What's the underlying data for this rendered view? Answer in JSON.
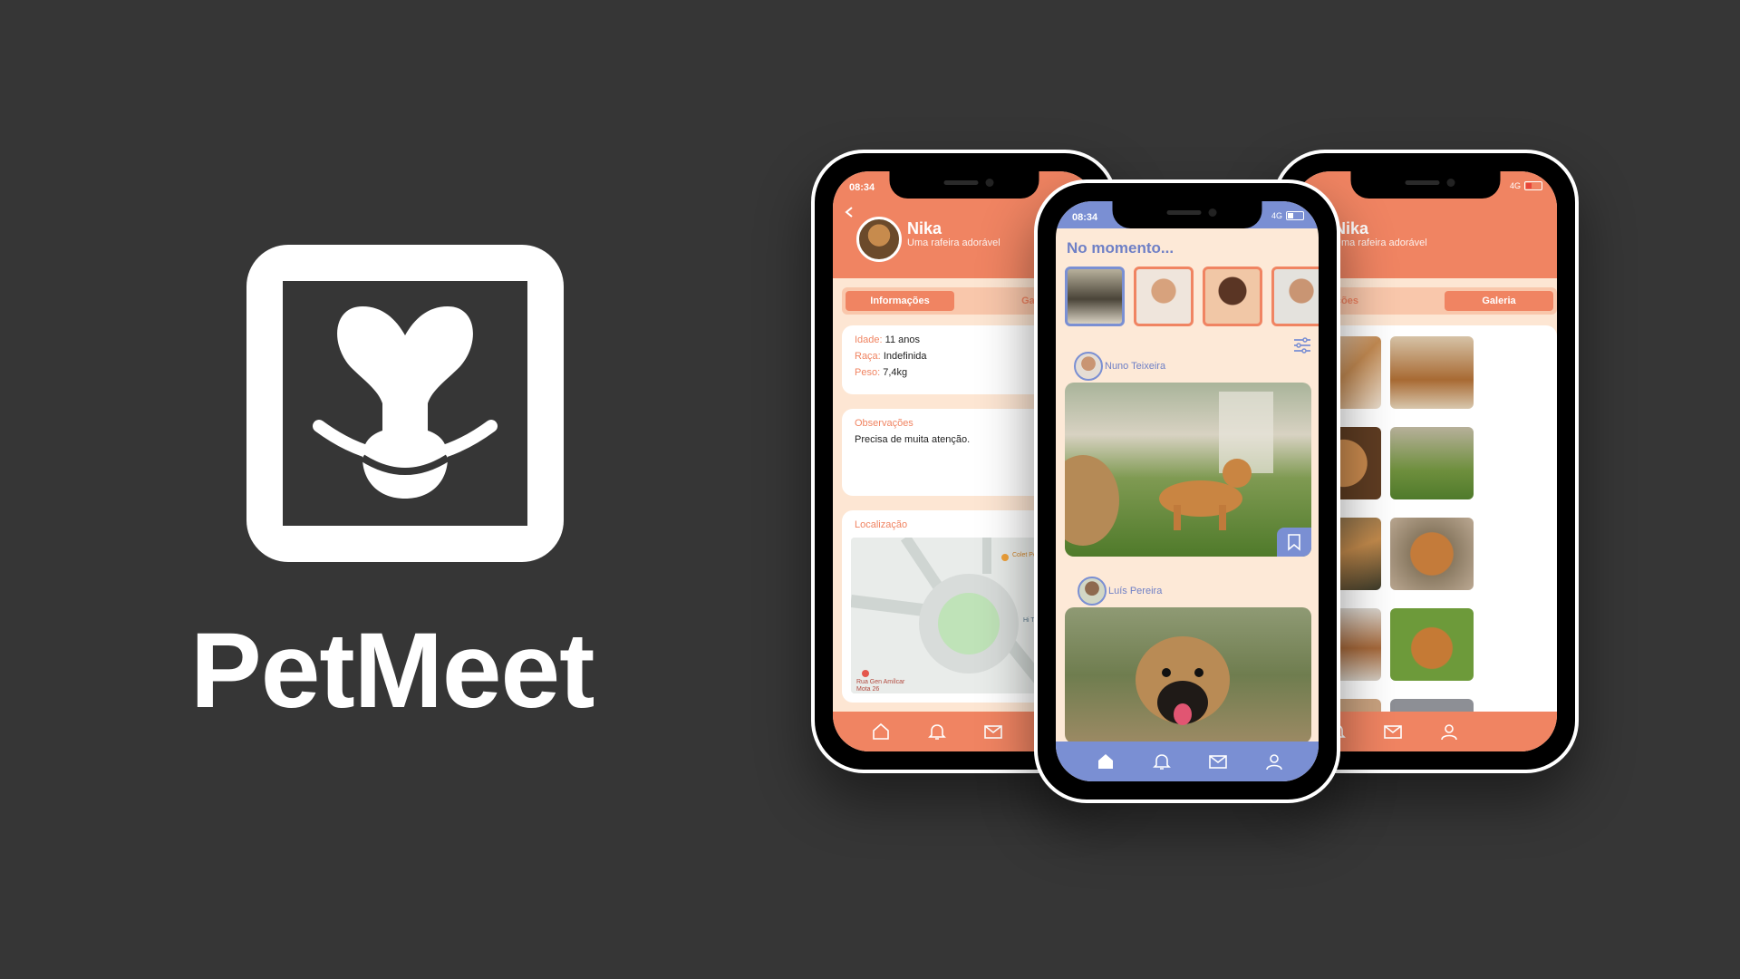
{
  "brand": {
    "name": "PetMeet"
  },
  "status": {
    "time": "08:34",
    "network": "4G"
  },
  "profile": {
    "name": "Nika",
    "subtitle": "Uma rafeira adorável",
    "tabs": [
      "Informações",
      "Galeria"
    ],
    "tab_right_partial": "Gale",
    "tab_left_partial": "ormações",
    "age_label": "Idade:",
    "age_value": "11 anos",
    "breed_label": "Raça:",
    "breed_value": "Indefinida",
    "weight_label": "Peso:",
    "weight_value": "7,4kg",
    "notes_title": "Observações",
    "notes_text": "Precisa de muita atenção.",
    "location_title": "Localização",
    "map_label_1": "Rua Gen Amílcar Mota 26",
    "map_label_2": "Colet Perm",
    "map_label_3": "Hi Tiag"
  },
  "feed": {
    "title": "No momento...",
    "posts": [
      {
        "author": "Nuno Teixeira"
      },
      {
        "author": "Luís Pereira"
      }
    ]
  },
  "icons": [
    "back-icon",
    "home-icon",
    "bell-icon",
    "mail-icon",
    "user-icon",
    "filter-icon",
    "bookmark-icon"
  ],
  "colors": {
    "orange": "#f08462",
    "blue": "#7a8fd3",
    "cream": "#fde6d3",
    "background": "#363636"
  }
}
